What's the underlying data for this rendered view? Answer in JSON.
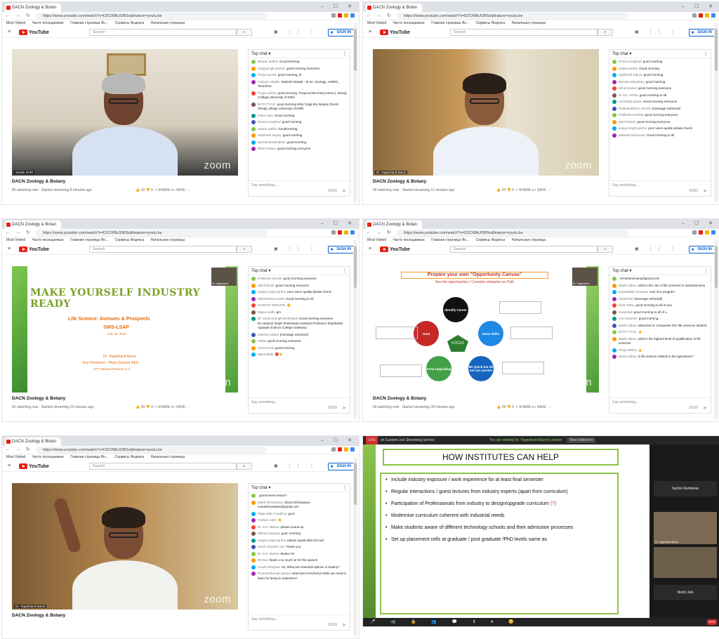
{
  "browser": {
    "tab_title": "DACN Zoology & Botany",
    "tab_title_short": "DACN Zoology & Botan",
    "url": "https://www.youtube.com/watch?v=DZCR8kJOBSo&feature=youtu.be",
    "bookmarks": [
      "Most Visited",
      "Часто посещаемые",
      "Главная страница Ян...",
      "Сервисы Яндекса",
      "Начальная страница"
    ]
  },
  "youtube": {
    "logo": "YouTube",
    "search_placeholder": "Search",
    "signin": "SIGN IN"
  },
  "colors": {
    "youtube_red": "#e62117",
    "slide_green": "#8bc34a",
    "slide_orange": "#e36c0a"
  },
  "panels": [
    {
      "video_title": "DACN Zoology & Botany",
      "meta": "86 watching now · Started streaming 8 minutes ago",
      "actions": "👍 12   👎 0   ↗ SHARE   ≡+ SAVE   ···",
      "speaker_label": "Sarath SHRI",
      "chat_header": "Top chat",
      "chat": [
        {
          "a": "Bharat Jadhav",
          "t": "Good Morning"
        },
        {
          "a": "sanjaysingh parihar",
          "t": "good morning everyone"
        },
        {
          "a": "Pooja Kamrik",
          "t": "good morning_3l"
        },
        {
          "a": "muliyam Madhu",
          "t": "Mukesh Meade - M.Sc. Zoology, JABRG, Shandora"
        },
        {
          "a": "Pooja Lamba",
          "t": "good morning ,Pooja at MAAmerj (Hons.), Shivaji College,University of Delhi"
        },
        {
          "a": "EKTA TYAGI",
          "t": "good morning Ekta Tyagi Bsc Botany (hons) Shivaji college university of Delhi"
        },
        {
          "a": "chitra sahu",
          "t": "Good morning"
        },
        {
          "a": "Roma Hoogheuf",
          "t": "good morning"
        },
        {
          "a": "uwasa sadhvi",
          "t": "Goodmorning"
        },
        {
          "a": "Siddharth Inqvay",
          "t": "good morning"
        },
        {
          "a": "Barnali Biswandeas",
          "t": "good morning"
        },
        {
          "a": "Elfrid Gaston",
          "t": "good morning everyone"
        }
      ],
      "chat_placeholder": "Say something...",
      "chat_count": "0/200"
    },
    {
      "video_title": "DACN Zoology & Botany",
      "meta": "90 watching now · Started streaming 11 minutes ago",
      "actions": "👍 24   👎 0   ↗ SHARE   ≡+ SAVE   ···",
      "speaker_label": "Dr. Yogeshand Barve",
      "chat_header": "Top chat",
      "chat": [
        {
          "a": "Roma Hoogheuf",
          "t": "good morning"
        },
        {
          "a": "uwasa sadhvi",
          "t": "Good morning"
        },
        {
          "a": "Siddharth Rajora",
          "t": "good morning"
        },
        {
          "a": "Barnali Satyadarty",
          "t": "good morning"
        },
        {
          "a": "Elfrid Gaston",
          "t": "good morning everyone"
        },
        {
          "a": "dr. a.k. Verma",
          "t": "good morning to all"
        },
        {
          "a": "Harshada pawar",
          "t": "Good morning everyone"
        },
        {
          "a": "Padmanabham Suresh",
          "t": "[message retracted]"
        },
        {
          "a": "Pratiksha Kamble",
          "t": "good morning everyone"
        },
        {
          "a": "Zainil dasari",
          "t": "good morning everyone"
        },
        {
          "a": "sanjay singh parihar",
          "t": "poor voice quality please check"
        },
        {
          "a": "Mahesh Nimarman",
          "t": "Good morning to all"
        }
      ],
      "chat_placeholder": "Say something...",
      "chat_count": "0/200"
    },
    {
      "video_title": "DACN Zoology & Botany",
      "meta": "42 watching now · Started streaming 19 minutes ago",
      "actions": "👍 29   👎 0   ↗ SHARE   ≡+ SAVE   ···",
      "slide_title": "MAKE YOURSELF INDUSTRY READY",
      "slide_sub1": "Life Science: Avenues & Prospects",
      "slide_sub2": "SWS-LSAP",
      "slide_date": "July 25, 2020",
      "slide_author1": "Dr. Yogeshand Barve",
      "slide_author2": "Vice President – Plant Science R&D",
      "slide_author3": "AFT Natural Products LLC",
      "cam_label": "Dr. Yogeshand",
      "chat_header": "Top chat",
      "chat": [
        {
          "a": "Pratiksha Sarode",
          "t": "good morning everyone"
        },
        {
          "a": "Zainil Brush",
          "t": "good morning everyone"
        },
        {
          "a": "sanjay singh parihar",
          "t": "poor voice quality please check"
        },
        {
          "a": "Mukeshwara Anant",
          "t": "Good morning to all"
        },
        {
          "a": "SAMANT DEEVIPE",
          "t": "🙂"
        },
        {
          "a": "Mayur andle",
          "t": "gm"
        },
        {
          "a": "Dr. AmarsolSinghShekhawat",
          "t": "Good morning everyone Dr.Amarsol Singh Shekhawat Assistant Professor Shankarlal Agrawal Science College Salekasa"
        },
        {
          "a": "malvina soltarit",
          "t": "[message retracted]"
        },
        {
          "a": "Pallav",
          "t": "good morning everyone"
        },
        {
          "a": "Apsit Kuma",
          "t": "good morning"
        },
        {
          "a": "Mana Belle",
          "t": "🔴👋"
        }
      ],
      "chat_placeholder": "Say something...",
      "chat_count": "0/200"
    },
    {
      "video_title": "DACN Zoology & Botany",
      "meta": "50 watching now · Started streaming 39 minutes ago",
      "actions": "👍 29   👎 0   ↗ SHARE   ≡+ SAVE   ···",
      "slide_title": "Prepare your own \"Opportunity Canvas\"",
      "slide_sub": "See the opportunities / Consider obstacles as Path",
      "circles": [
        "Identify Career",
        "Hone Skills",
        "Be Quick but do not cut corners",
        "Keep Upgrading",
        "Goal"
      ],
      "center": "FOCUS",
      "cam_label": "Dr. Yogeshand",
      "chat_header": "Top chat",
      "chat": [
        {
          "a": "",
          "t": "dAnshamirvana@gmail.com"
        },
        {
          "a": "akash dubey",
          "t": "what is the role of life sciences in industrial area"
        },
        {
          "a": "priyasakalp sivaramy",
          "t": "very nice program"
        },
        {
          "a": "Swati Rao",
          "t": "[message retracted]"
        },
        {
          "a": "Kiran Babu",
          "t": "good morning to all of you"
        },
        {
          "a": "Swati Bali",
          "t": "good morning to all of u"
        },
        {
          "a": "Jon Chauhan",
          "t": "good morning..."
        },
        {
          "a": "akash dubey",
          "t": "what kind or companies hire life sciences student"
        },
        {
          "a": "EKTA TYAGI",
          "t": "👍"
        },
        {
          "a": "akash dubey",
          "t": "what is the highest level of qualification in life sciences"
        },
        {
          "a": "Pooja Mehra",
          "t": "👍"
        },
        {
          "a": "akash dubey",
          "t": "is life science related to the agriculture?"
        }
      ],
      "chat_placeholder": "Say something...",
      "chat_count": "0/200"
    },
    {
      "video_title": "DACN Zoology & Botany",
      "meta": "",
      "actions": "",
      "speaker_label": "Dr. Yogeshand Barve",
      "chat_header": "Top chat",
      "chat": [
        {
          "a": "",
          "t": "government sector?"
        },
        {
          "a": "Mardi Shrivastava",
          "t": "Shruti Shrivastava somashrivastava@gmail.com"
        },
        {
          "a": "Srijan Bids Academy",
          "t": "gooc"
        },
        {
          "a": "Yoshion zabri",
          "t": "👏"
        },
        {
          "a": "Dr. S.K. Meena",
          "t": "please sound up"
        },
        {
          "a": "Mamta Ganguly",
          "t": "gooc morning"
        },
        {
          "a": "sanjay singh parihar",
          "t": "please speak little bit loud"
        },
        {
          "a": "Harsh Shanker Kar",
          "t": "Thank you"
        },
        {
          "a": "Dr. S.K. Meena",
          "t": "thanks Sir"
        },
        {
          "a": "Mr Das",
          "t": "thank u so much sir for the speech"
        },
        {
          "a": "Anudri Bhegwat",
          "t": "Sir, What are essential options in botany?"
        },
        {
          "a": "Poonamkhumar Bansal",
          "t": "what kind of technical skills we need to learn for being in industries?"
        }
      ],
      "chat_placeholder": "Say something...",
      "chat_count": "0/200"
    }
  ],
  "zoom": {
    "badge": "LIVE",
    "stream_label": "on Custom Live Streaming Service",
    "speaking": "You are viewing Dr. Yogeshand Barve's screen",
    "options": "View Options ▾",
    "slide_title": "HOW INSTITUTES CAN HELP",
    "bullets": [
      {
        "t": "Include industry exposure / work experience for at least final semester",
        "r": ""
      },
      {
        "t": "Regular interactions / guest lectures from industry experts (apart from curriculum)",
        "r": ""
      },
      {
        "t": "Participation of Professionals from industry to design/upgrade curriculum ",
        "r": "(?)"
      },
      {
        "t": "Modernise curriculum coherent with industrial needs",
        "r": ""
      },
      {
        "t": "Make students aware of different technology schools and their admission processes",
        "r": ""
      },
      {
        "t": "Set up placement cells at graduate / post graduate /PhD levels same as",
        "r": ""
      }
    ],
    "participants": [
      "Sachin Ramtekar",
      "Dr. Yogeshand Barve",
      "Nishit Jain"
    ],
    "end": "End"
  },
  "logo_text": "zoom"
}
